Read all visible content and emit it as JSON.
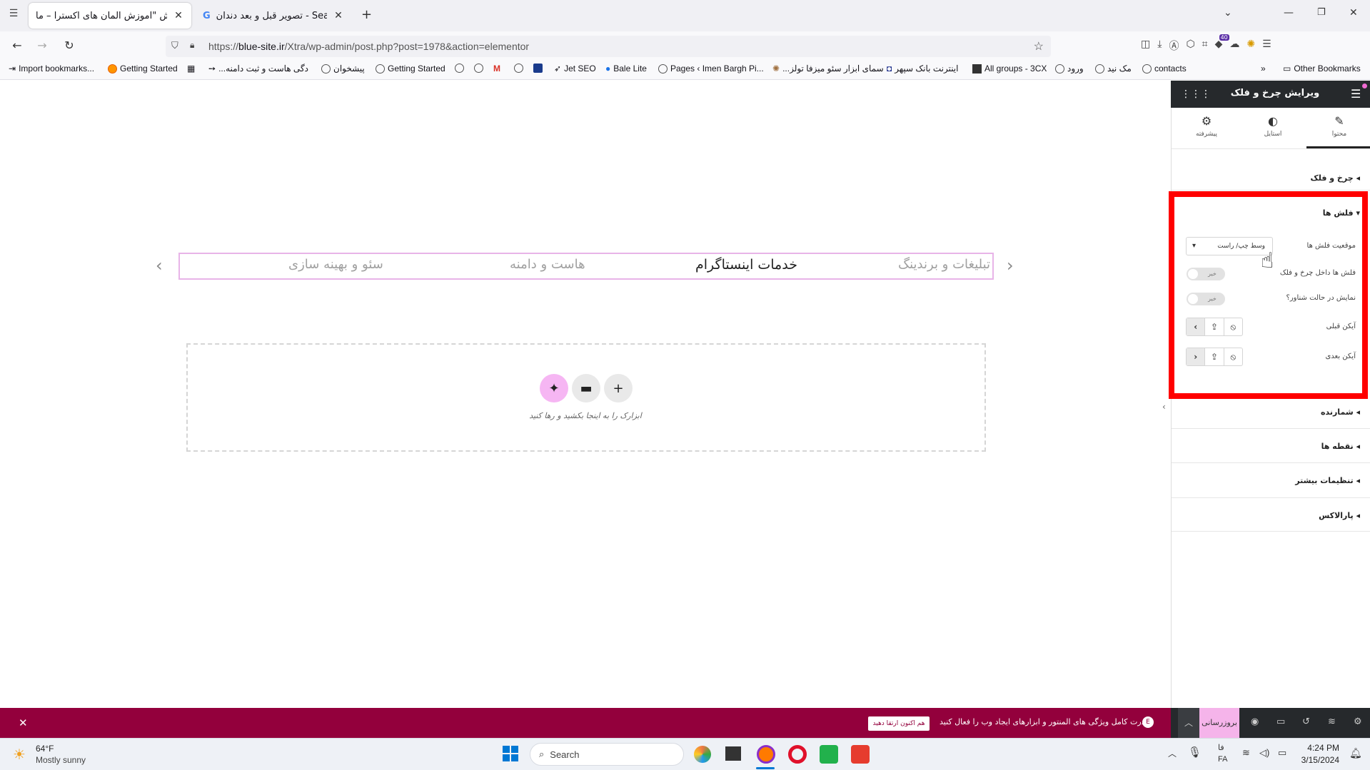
{
  "tabs": [
    {
      "title": "ویرایش \"آموزش المان های اکسترا – ما",
      "active": true
    },
    {
      "title": "تصویر قبل و بعد دندان - Search",
      "active": false
    }
  ],
  "url": {
    "prefix": "https://",
    "domain": "blue-site.ir",
    "path": "/Xtra/wp-admin/post.php?post=1978&action=elementor"
  },
  "bookmarks": [
    "Import bookmarks...",
    "Getting Started",
    "...دگی هاست و ثبت دامنه",
    "پیشخوان",
    "Getting Started",
    "Jet SEO",
    "Bale Lite",
    "Pages ‹ Imen Bargh Pi...",
    "...سمای ابزار سئو میزفا تولز",
    "اینترنت بانک سپهر",
    "All groups - 3CX",
    "ورود",
    "مک نید",
    "contacts",
    "Other Bookmarks"
  ],
  "bookmark_badge": "40",
  "carousel": {
    "items": [
      "تبلیغات و برندینگ",
      "خدمات اینستاگرام",
      "هاست و دامنه",
      "سئو و بهینه سازی"
    ],
    "active_index": 1
  },
  "dropzone": {
    "text": "ابزارک را به اینجا بکشید و رها کنید"
  },
  "panel": {
    "title": "ویرایش چرخ و فلک",
    "tabs": [
      "محتوا",
      "استایل",
      "پیشرفته"
    ],
    "sections": {
      "carousel": "چرخ و فلک",
      "arrows": "فلش ها",
      "counter": "شمارنده",
      "dots": "نقطه ها",
      "more": "تنظیمات بیشتر",
      "parallax": "پارالاکس"
    },
    "fields": {
      "arrows_position_label": "موقعیت فلش ها",
      "arrows_position_value": "وسط چپ/ راست",
      "arrows_inside_label": "فلش ها داخل چرخ و فلک",
      "arrows_inside_value": "خیر",
      "show_floating_label": "نمایش در حالت شناور؟",
      "show_floating_value": "خیر",
      "prev_icon_label": "آیکن قبلی",
      "next_icon_label": "آیکن بعدی"
    }
  },
  "notice": {
    "text": "قدرت کامل ویژگی های المنتور و ابزارهای ایجاد وب را فعال کنید.",
    "button": "هم اکنون ارتقا دهید"
  },
  "bottombar": {
    "update": "بروزرسانی"
  },
  "taskbar": {
    "temp": "64°F",
    "weather": "Mostly sunny",
    "search_placeholder": "Search",
    "lang_top": "فا",
    "lang_bottom": "FA",
    "time": "4:24 PM",
    "date": "3/15/2024"
  },
  "colors": {
    "notice_bg": "#93003c",
    "panel_dark": "#26292c",
    "highlight": "#ff0000",
    "carousel_border": "#e8b4e8"
  }
}
